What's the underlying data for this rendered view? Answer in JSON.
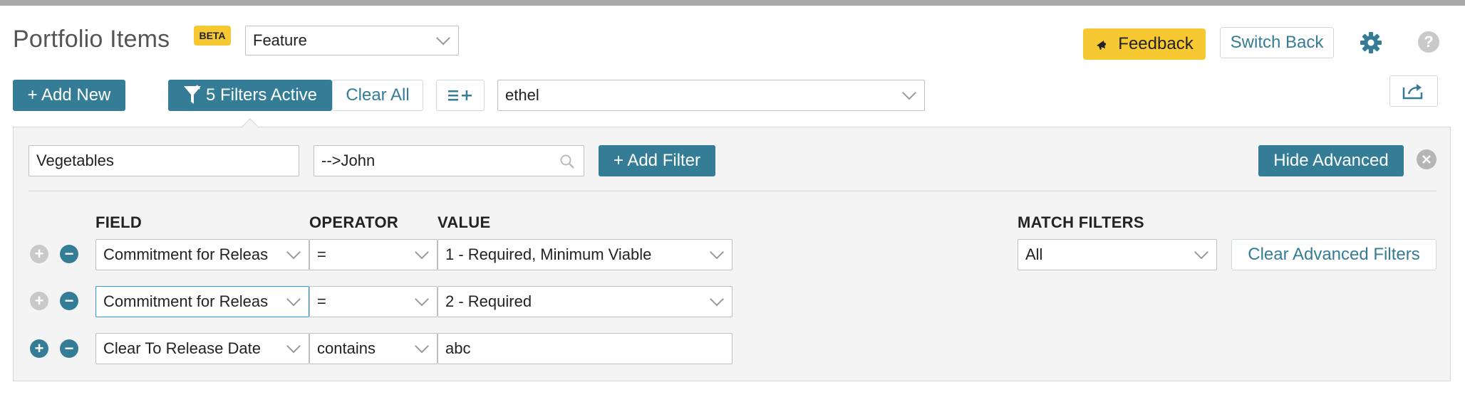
{
  "header": {
    "title": "Portfolio Items",
    "badge": "BETA",
    "type_select": "Feature",
    "feedback_label": "Feedback",
    "switch_back_label": "Switch Back"
  },
  "toolbar": {
    "add_new_label": "+ Add New",
    "filters_active_label": "5 Filters Active",
    "clear_all_label": "Clear All",
    "owner_select": "ethel"
  },
  "filter_panel": {
    "keyword_input": "Vegetables",
    "user_search_input": "-->John",
    "add_filter_label": "+ Add Filter",
    "hide_advanced_label": "Hide Advanced"
  },
  "advanced": {
    "headers": {
      "field": "FIELD",
      "operator": "OPERATOR",
      "value": "VALUE",
      "match": "MATCH FILTERS"
    },
    "rows": [
      {
        "field": "Commitment for Releas",
        "operator": "=",
        "value": "1 - Required, Minimum Viable"
      },
      {
        "field": "Commitment for Releas",
        "operator": "=",
        "value": "2 - Required"
      },
      {
        "field": "Clear To Release Date",
        "operator": "contains",
        "value": "abc"
      }
    ],
    "match_select": "All",
    "clear_advanced_label": "Clear Advanced Filters"
  },
  "colors": {
    "accent": "#357d96",
    "badge": "#f6c933",
    "panel": "#f4f4f4"
  },
  "icons": [
    "megaphone-icon",
    "gear-icon",
    "help-icon",
    "filter-icon",
    "add-column-icon",
    "export-icon",
    "search-icon",
    "close-circle-icon",
    "plus-circle-icon",
    "minus-circle-icon",
    "chevron-down-icon"
  ]
}
